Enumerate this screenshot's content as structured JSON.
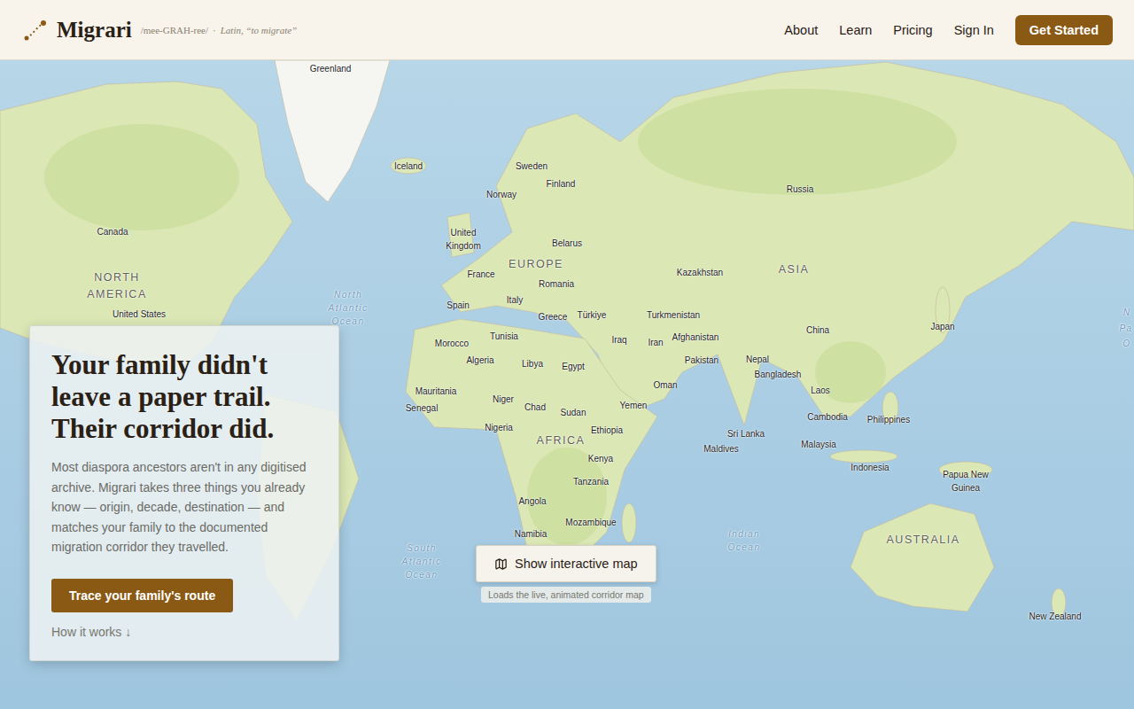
{
  "brand": {
    "name": "Migrari",
    "pronunciation": "/mee-GRAH-ree/",
    "separator": "·",
    "meaning": "Latin, “to migrate”"
  },
  "nav": {
    "links": [
      "About",
      "Learn",
      "Pricing",
      "Sign In"
    ],
    "cta": "Get Started"
  },
  "hero": {
    "title": "Your family didn't leave a paper trail. Their corridor did.",
    "body": "Most diaspora ancestors aren't in any digitised archive. Migrari takes three things you already know — origin, decade, destination — and matches your family to the documented migration corridor they travelled.",
    "button": "Trace your family's route",
    "link": "How it works ↓"
  },
  "map_button": {
    "label": "Show interactive map",
    "caption": "Loads the live, animated corridor map"
  },
  "map_labels": [
    {
      "text": "Greenland",
      "kind": "country"
    },
    {
      "text": "Iceland",
      "kind": "country"
    },
    {
      "text": "Sweden",
      "kind": "country"
    },
    {
      "text": "Finland",
      "kind": "country"
    },
    {
      "text": "Norway",
      "kind": "country"
    },
    {
      "text": "Russia",
      "kind": "country"
    },
    {
      "text": "Canada",
      "kind": "country"
    },
    {
      "text": "United Kingdom",
      "kind": "country"
    },
    {
      "text": "Belarus",
      "kind": "country"
    },
    {
      "text": "EUROPE",
      "kind": "region"
    },
    {
      "text": "France",
      "kind": "country"
    },
    {
      "text": "Romania",
      "kind": "country"
    },
    {
      "text": "Kazakhstan",
      "kind": "country"
    },
    {
      "text": "ASIA",
      "kind": "region"
    },
    {
      "text": "NORTH AMERICA",
      "kind": "region"
    },
    {
      "text": "United States",
      "kind": "country"
    },
    {
      "text": "North Atlantic Ocean",
      "kind": "ocean"
    },
    {
      "text": "Spain",
      "kind": "country"
    },
    {
      "text": "Italy",
      "kind": "country"
    },
    {
      "text": "Greece",
      "kind": "country"
    },
    {
      "text": "Türkiye",
      "kind": "country"
    },
    {
      "text": "Turkmenistan",
      "kind": "country"
    },
    {
      "text": "Tunisia",
      "kind": "country"
    },
    {
      "text": "Morocco",
      "kind": "country"
    },
    {
      "text": "Iraq",
      "kind": "country"
    },
    {
      "text": "Iran",
      "kind": "country"
    },
    {
      "text": "Afghanistan",
      "kind": "country"
    },
    {
      "text": "Pakistan",
      "kind": "country"
    },
    {
      "text": "China",
      "kind": "country"
    },
    {
      "text": "Japan",
      "kind": "country"
    },
    {
      "text": "Algeria",
      "kind": "country"
    },
    {
      "text": "Libya",
      "kind": "country"
    },
    {
      "text": "Egypt",
      "kind": "country"
    },
    {
      "text": "Nepal",
      "kind": "country"
    },
    {
      "text": "Bangladesh",
      "kind": "country"
    },
    {
      "text": "Oman",
      "kind": "country"
    },
    {
      "text": "Mauritania",
      "kind": "country"
    },
    {
      "text": "Senegal",
      "kind": "country"
    },
    {
      "text": "Niger",
      "kind": "country"
    },
    {
      "text": "Chad",
      "kind": "country"
    },
    {
      "text": "Sudan",
      "kind": "country"
    },
    {
      "text": "Yemen",
      "kind": "country"
    },
    {
      "text": "Laos",
      "kind": "country"
    },
    {
      "text": "Nigeria",
      "kind": "country"
    },
    {
      "text": "Ethiopia",
      "kind": "country"
    },
    {
      "text": "AFRICA",
      "kind": "region"
    },
    {
      "text": "Cambodia",
      "kind": "country"
    },
    {
      "text": "Philippines",
      "kind": "country"
    },
    {
      "text": "Sri Lanka",
      "kind": "country"
    },
    {
      "text": "Maldives",
      "kind": "country"
    },
    {
      "text": "Malaysia",
      "kind": "country"
    },
    {
      "text": "Kenya",
      "kind": "country"
    },
    {
      "text": "Indonesia",
      "kind": "country"
    },
    {
      "text": "Papua New Guinea",
      "kind": "country"
    },
    {
      "text": "Tanzania",
      "kind": "country"
    },
    {
      "text": "Angola",
      "kind": "country"
    },
    {
      "text": "Mozambique",
      "kind": "country"
    },
    {
      "text": "Namibia",
      "kind": "country"
    },
    {
      "text": "South Atlantic Ocean",
      "kind": "ocean"
    },
    {
      "text": "Indian Ocean",
      "kind": "ocean"
    },
    {
      "text": "AUSTRALIA",
      "kind": "region"
    },
    {
      "text": "New Zealand",
      "kind": "country"
    },
    {
      "text": "N",
      "kind": "ocean"
    },
    {
      "text": "Pa",
      "kind": "ocean"
    },
    {
      "text": "O",
      "kind": "ocean"
    }
  ]
}
